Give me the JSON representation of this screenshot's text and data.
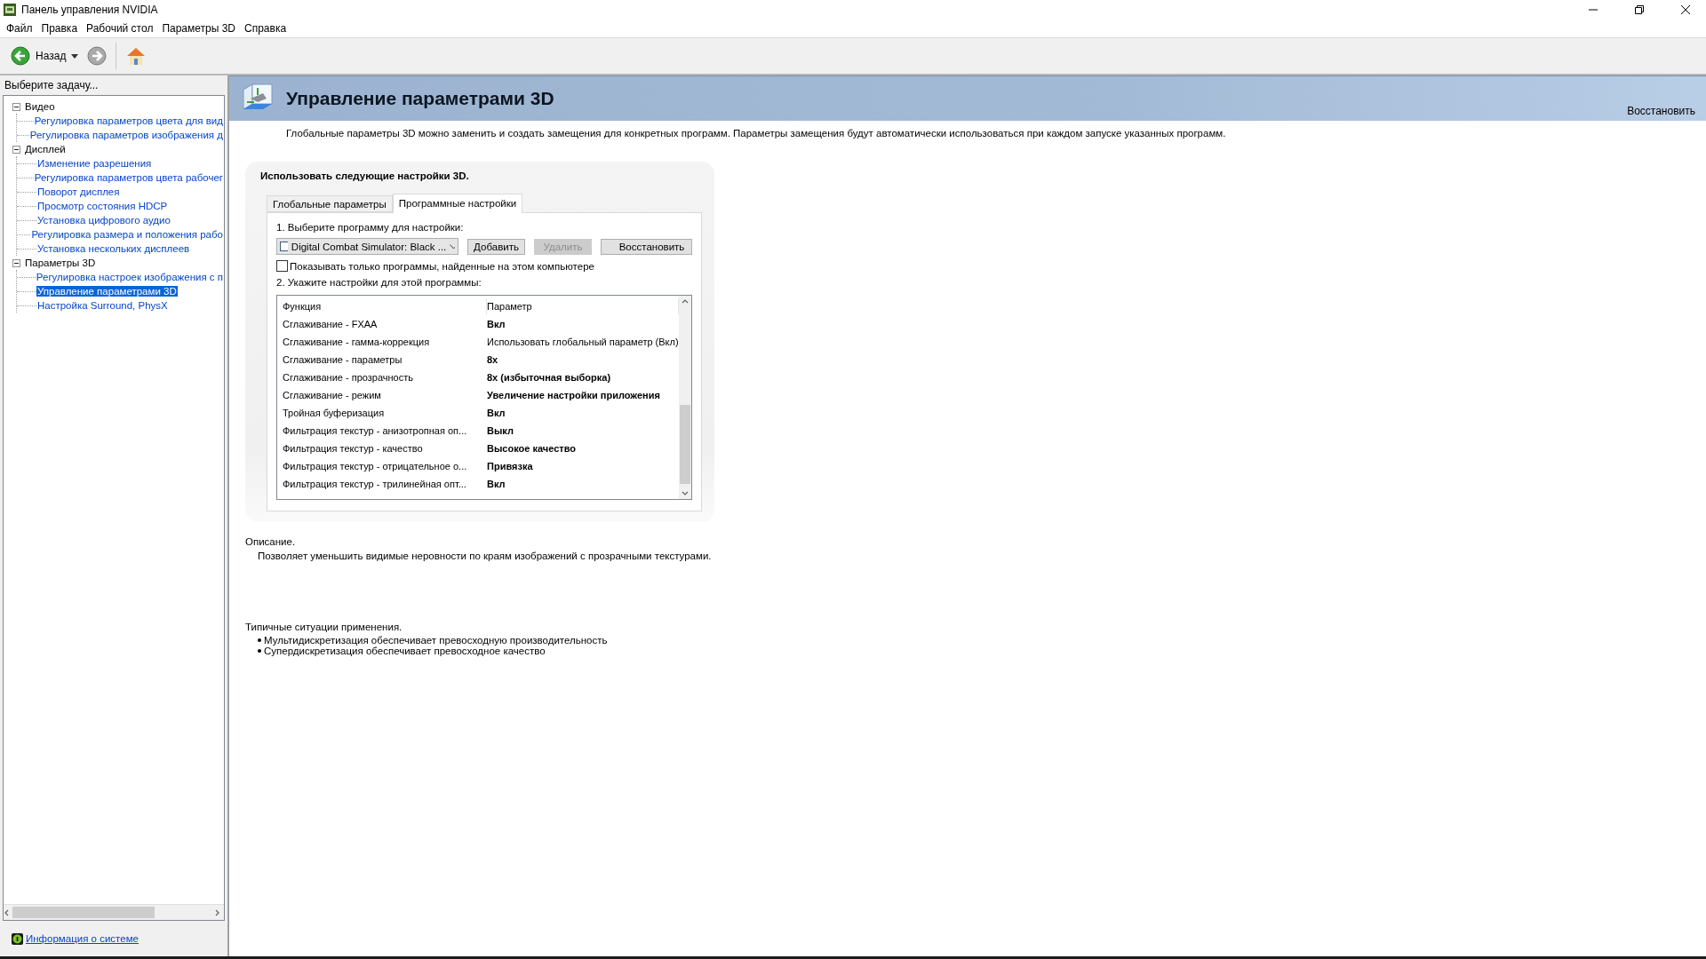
{
  "window": {
    "title": "Панель управления NVIDIA"
  },
  "menu": [
    "Файл",
    "Правка",
    "Рабочий стол",
    "Параметры 3D",
    "Справка"
  ],
  "toolbar": {
    "back_label": "Назад"
  },
  "sidebar": {
    "heading": "Выберите задачу...",
    "tree": [
      {
        "label": "Видео",
        "expanded": true,
        "children": [
          {
            "label": "Регулировка параметров цвета для вид",
            "selected": false
          },
          {
            "label": "Регулировка параметров изображения д",
            "selected": false
          }
        ]
      },
      {
        "label": "Дисплей",
        "expanded": true,
        "children": [
          {
            "label": "Изменение разрешения",
            "selected": false
          },
          {
            "label": "Регулировка параметров цвета рабочег",
            "selected": false
          },
          {
            "label": "Поворот дисплея",
            "selected": false
          },
          {
            "label": "Просмотр состояния HDCP",
            "selected": false
          },
          {
            "label": "Установка цифрового аудио",
            "selected": false
          },
          {
            "label": "Регулировка размера и положения рабо",
            "selected": false
          },
          {
            "label": "Установка нескольких дисплеев",
            "selected": false
          }
        ]
      },
      {
        "label": "Параметры 3D",
        "expanded": true,
        "children": [
          {
            "label": "Регулировка настроек изображения с п",
            "selected": false
          },
          {
            "label": "Управление параметрами 3D",
            "selected": true
          },
          {
            "label": "Настройка Surround, PhysX",
            "selected": false
          }
        ]
      }
    ],
    "link": "Информация о системе"
  },
  "header": {
    "title": "Управление параметрами 3D",
    "restore": "Восстановить"
  },
  "intro": "Глобальные параметры 3D можно заменить и создать замещения для конкретных программ. Параметры замещения будут автоматически использоваться при каждом запуске указанных программ.",
  "panel": {
    "heading": "Использовать следующие настройки 3D.",
    "tabs": [
      {
        "label": "Глобальные параметры",
        "selected": false
      },
      {
        "label": "Программные настройки",
        "selected": true
      }
    ],
    "step1": "1. Выберите программу для настройки:",
    "program": "Digital Combat Simulator: Black ...",
    "buttons": [
      {
        "label": "Добавить",
        "disabled": false,
        "kind": "plain"
      },
      {
        "label": "Удалить",
        "disabled": true,
        "kind": "plain"
      },
      {
        "label": "Восстановить",
        "disabled": false,
        "kind": "nvidia"
      }
    ],
    "checkbox": {
      "label": "Показывать только программы, найденные на этом компьютере",
      "checked": false
    },
    "step2": "2. Укажите настройки для этой программы:",
    "table": {
      "columns": [
        "Функция",
        "Параметр"
      ],
      "rows": [
        {
          "function": "Сглаживание - FXAA",
          "value": "Вкл",
          "kind": "custom"
        },
        {
          "function": "Сглаживание - гамма-коррекция",
          "value": "Использовать глобальный параметр (Вкл)",
          "kind": "global"
        },
        {
          "function": "Сглаживание - параметры",
          "value": "8x",
          "kind": "custom"
        },
        {
          "function": "Сглаживание - прозрачность",
          "value": "8x (избыточная выборка)",
          "kind": "custom"
        },
        {
          "function": "Сглаживание - режим",
          "value": "Увеличение настройки приложения",
          "kind": "custom"
        },
        {
          "function": "Тройная буферизация",
          "value": "Вкл",
          "kind": "custom"
        },
        {
          "function": "Фильтрация текстур - анизотропная оп...",
          "value": "Выкл",
          "kind": "custom"
        },
        {
          "function": "Фильтрация текстур - качество",
          "value": "Высокое качество",
          "kind": "custom"
        },
        {
          "function": "Фильтрация текстур - отрицательное о...",
          "value": "Привязка",
          "kind": "custom"
        },
        {
          "function": "Фильтрация текстур - трилинейная опт...",
          "value": "Вкл",
          "kind": "custom"
        }
      ]
    }
  },
  "description": {
    "heading": "Описание.",
    "text": "Позволяет уменьшить видимые неровности по краям изображений с прозрачными текстурами."
  },
  "usage": {
    "heading": "Типичные ситуации применения.",
    "bullets": [
      "Мультидискретизация обеспечивает превосходную производительность",
      "Супердискретизация обеспечивает превосходное качество"
    ]
  }
}
